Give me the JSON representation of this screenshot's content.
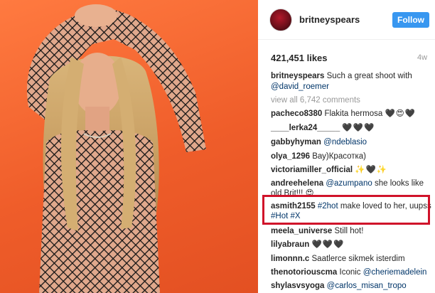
{
  "post": {
    "username": "britneyspears",
    "follow_label": "Follow",
    "likes": "421,451 likes",
    "age": "4w",
    "caption": {
      "user": "britneyspears",
      "text": "Such a great shoot with",
      "mention": "@david_roemer"
    },
    "view_all": "view all 6,742 comments"
  },
  "comments": [
    {
      "user": "pacheco8380",
      "text": "Flakita hermosa",
      "emoji": "🖤😍🖤"
    },
    {
      "user": "____lerka24_____",
      "text": "",
      "emoji": "🖤🖤🖤"
    },
    {
      "user": "gabbyhyman",
      "text": "",
      "mention": "@ndeblasio"
    },
    {
      "user": "olya_1296",
      "text": "Вау)Красотка)"
    },
    {
      "user": "victoriamiller_official",
      "text": "",
      "emoji": "✨🖤✨"
    },
    {
      "user": "andreehelena",
      "mention": "@azumpano",
      "text": "she looks like old Brit!!!",
      "emoji": "😍"
    },
    {
      "user": "asmith2155",
      "tag1": "#2hot",
      "text": "make loved to her, uupss",
      "tag2": "#Hot",
      "tag3": "#X"
    },
    {
      "user": "meela_universe",
      "text": "Still hot!"
    },
    {
      "user": "lilyabraun",
      "text": "",
      "emoji": "🖤🖤🖤"
    },
    {
      "user": "limonnn.c",
      "text": "Saatlerce sikmek isterdim"
    },
    {
      "user": "thenotoriouscma",
      "text": "Iconic",
      "mention": "@cheriemadelein"
    },
    {
      "user": "shylasvsyoga",
      "mention": "@carlos_misan_tropo"
    }
  ],
  "colors": {
    "photo_background": "#ef5d2a",
    "follow_button": "#3897f0",
    "highlight_box": "#d0122a",
    "link": "#003569"
  },
  "icons": {
    "avatar": "profile-avatar"
  }
}
